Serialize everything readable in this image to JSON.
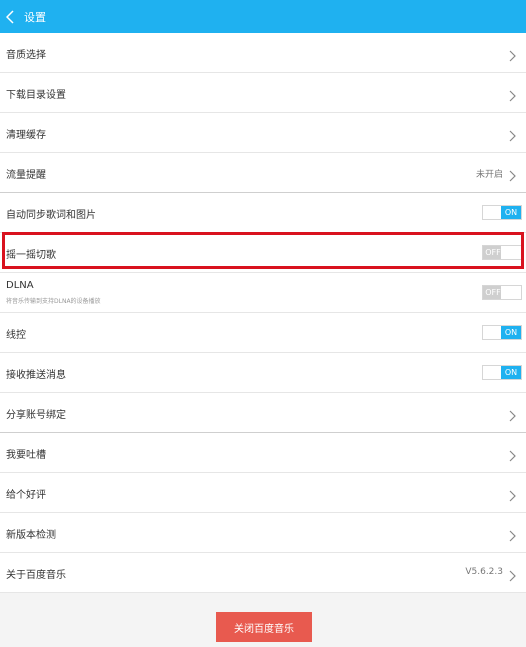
{
  "header": {
    "title": "设置"
  },
  "rows": [
    {
      "label": "音质选择"
    },
    {
      "label": "下载目录设置"
    },
    {
      "label": "清理缓存"
    },
    {
      "label": "流量提醒",
      "value": "未开启"
    },
    {
      "label": "自动同步歌词和图片",
      "toggle": "ON"
    },
    {
      "label": "摇一摇切歌",
      "toggle": "OFF"
    },
    {
      "label": "DLNA",
      "sub": "将音乐传输到支持DLNA的设备播放",
      "toggle": "OFF"
    },
    {
      "label": "线控",
      "toggle": "ON"
    },
    {
      "label": "接收推送消息",
      "toggle": "ON"
    },
    {
      "label": "分享账号绑定"
    },
    {
      "label": "我要吐槽"
    },
    {
      "label": "给个好评"
    },
    {
      "label": "新版本检测"
    },
    {
      "label": "关于百度音乐",
      "value": "V5.6.2.3"
    }
  ],
  "close_button": {
    "label": "关闭百度音乐"
  },
  "colors": {
    "header": "#1fb1f0",
    "toggle_on": "#1fb1f0",
    "close_button": "#e85a4f",
    "highlight": "#d9121e"
  }
}
